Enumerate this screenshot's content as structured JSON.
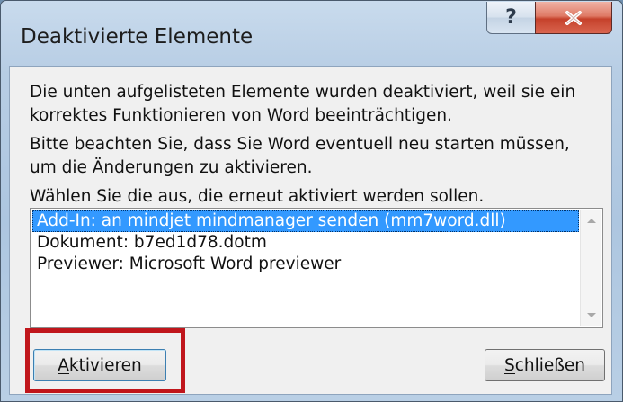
{
  "dialog": {
    "title": "Deaktivierte Elemente",
    "help_button": "?",
    "close_button_icon": "close-icon"
  },
  "body": {
    "paragraph1_line1": "Die unten aufgelisteten Elemente wurden deaktiviert, weil sie ein",
    "paragraph1_line2": "korrektes Funktionieren von Word beeinträchtigen.",
    "paragraph2_line1": "Bitte beachten Sie, dass Sie Word eventuell neu starten müssen,",
    "paragraph2_line2": "um die Änderungen zu aktivieren.",
    "prompt": "Wählen Sie die aus, die erneut aktiviert werden sollen."
  },
  "list": {
    "items": [
      {
        "label": "Add-In: an mindjet mindmanager senden (mm7word.dll)",
        "selected": true
      },
      {
        "label": "Dokument: b7ed1d78.dotm",
        "selected": false
      },
      {
        "label": "Previewer: Microsoft Word previewer",
        "selected": false
      }
    ]
  },
  "buttons": {
    "activate": "Aktivieren",
    "close": "Schließen"
  },
  "colors": {
    "selection": "#3399ff",
    "highlight_box": "#c0161c",
    "close_button": "#c5412b"
  }
}
